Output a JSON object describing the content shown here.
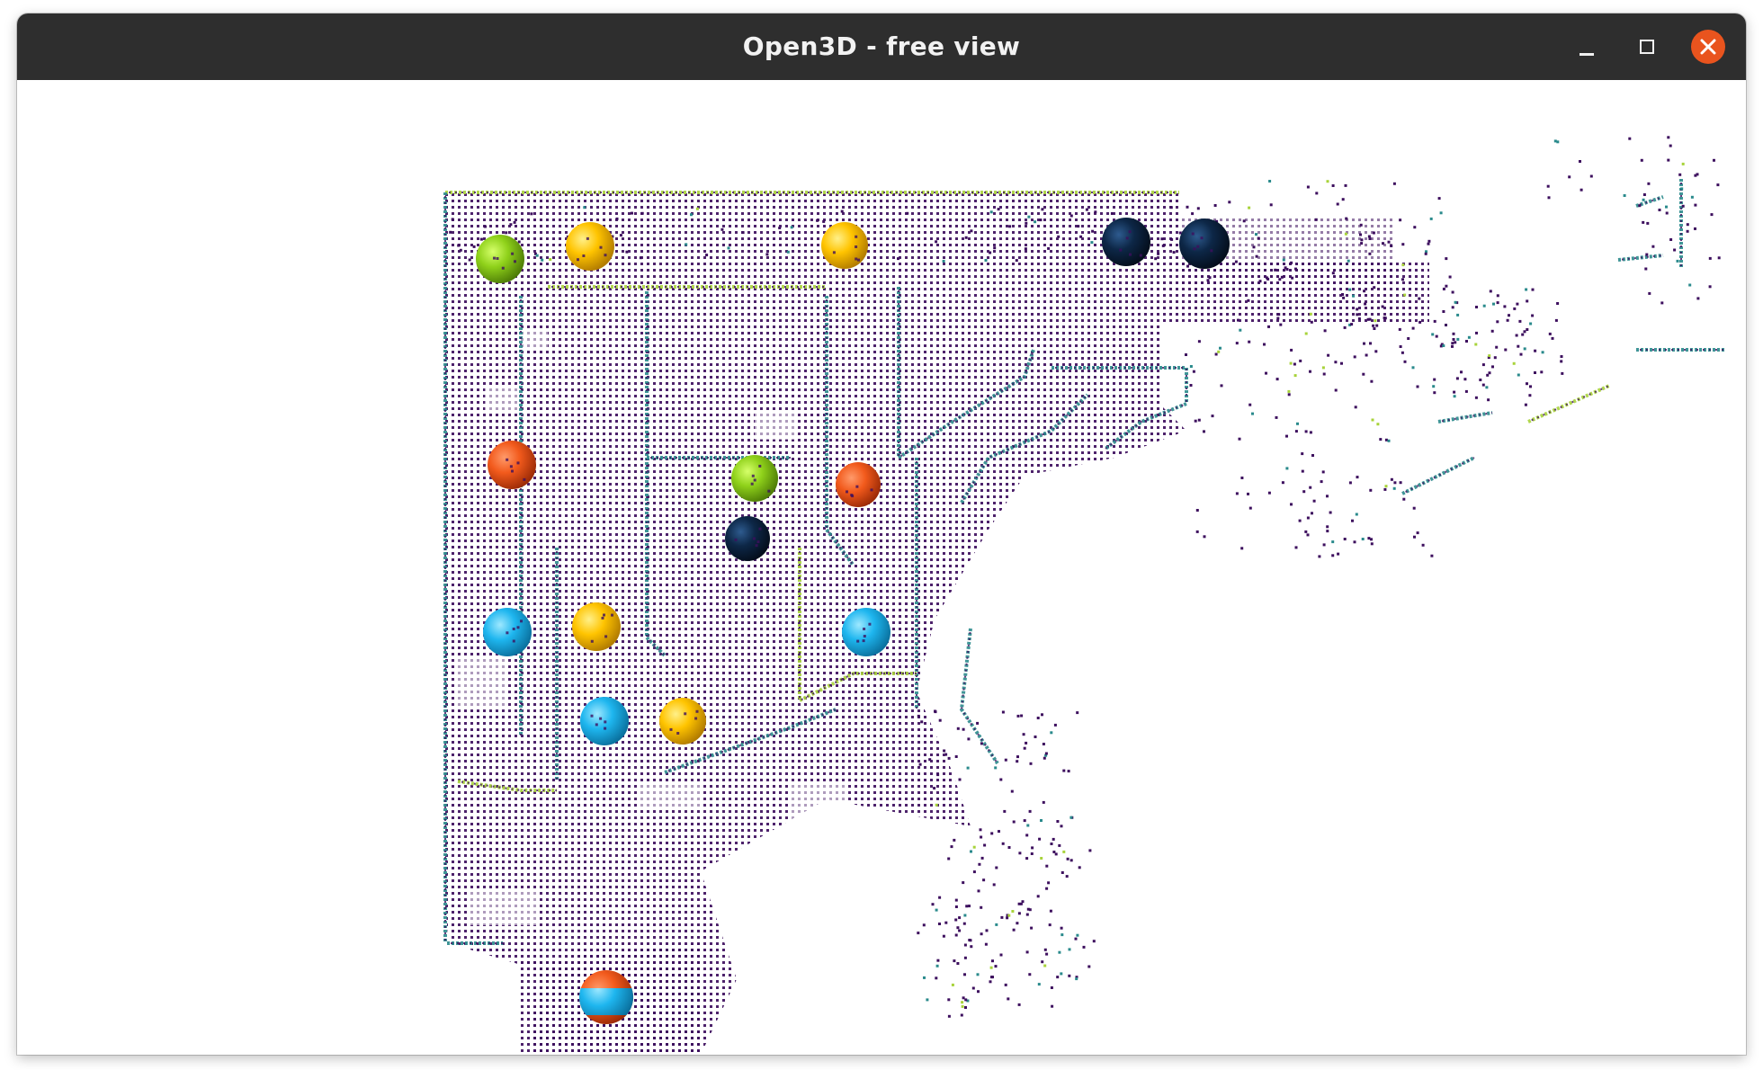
{
  "window": {
    "title": "Open3D - free view"
  },
  "colors": {
    "titlebar": "#2e2e2e",
    "close_button": "#e9541e",
    "point_primary": "#3d0f5e",
    "point_teal": "#2a8a8c",
    "point_lime": "#a8d33a",
    "sphere_green": "#8fd11a",
    "sphere_yellow": "#ffc400",
    "sphere_orange": "#f25a1c",
    "sphere_navy": "#0d2747",
    "sphere_cyan": "#1eb6ef"
  },
  "icons": [
    "minimize-icon",
    "maximize-icon",
    "close-icon"
  ]
}
